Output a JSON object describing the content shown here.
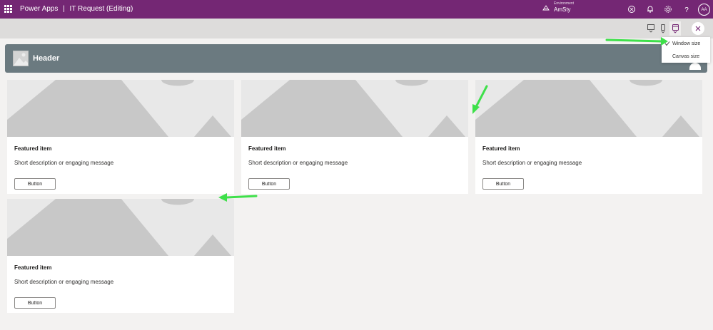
{
  "topbar": {
    "app_name": "Power Apps",
    "separator": "|",
    "document_title": "IT Request (Editing)",
    "environment_label": "Environment",
    "environment_name": "AmSty",
    "avatar_initials": "AA",
    "brand_color": "#742774",
    "icons": [
      "copilot-icon",
      "bell-icon",
      "gear-icon",
      "help-icon"
    ]
  },
  "size_menu": {
    "items": [
      {
        "label": "Window size",
        "checked": true
      },
      {
        "label": "Canvas size",
        "checked": false
      }
    ]
  },
  "header": {
    "title": "Header",
    "color": "#6b7a80"
  },
  "cards": [
    {
      "title": "Featured item",
      "description": "Short description or engaging message",
      "button_label": "Button"
    },
    {
      "title": "Featured item",
      "description": "Short description or engaging message",
      "button_label": "Button"
    },
    {
      "title": "Featured item",
      "description": "Short description or engaging message",
      "button_label": "Button"
    },
    {
      "title": "Featured item",
      "description": "Short description or engaging message",
      "button_label": "Button"
    }
  ],
  "annotation_color": "#3ee04a"
}
